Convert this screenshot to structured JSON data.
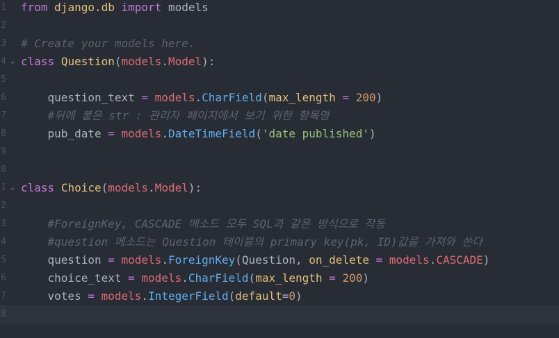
{
  "editor": {
    "language": "python",
    "lines": [
      {
        "num": "1",
        "fold": false,
        "segments": [
          {
            "t": "from",
            "c": "kw"
          },
          {
            "t": " "
          },
          {
            "t": "django.db",
            "c": "mod"
          },
          {
            "t": " "
          },
          {
            "t": "import",
            "c": "kw"
          },
          {
            "t": " models"
          }
        ]
      },
      {
        "num": "2",
        "fold": false,
        "segments": []
      },
      {
        "num": "3",
        "fold": false,
        "segments": [
          {
            "t": "# Create your models here.",
            "c": "cmt"
          }
        ]
      },
      {
        "num": "4",
        "fold": true,
        "segments": [
          {
            "t": "class",
            "c": "kw"
          },
          {
            "t": " "
          },
          {
            "t": "Question",
            "c": "cls"
          },
          {
            "t": "("
          },
          {
            "t": "models",
            "c": "name"
          },
          {
            "t": "."
          },
          {
            "t": "Model",
            "c": "name"
          },
          {
            "t": "):"
          }
        ]
      },
      {
        "num": "5",
        "fold": false,
        "segments": []
      },
      {
        "num": "6",
        "fold": false,
        "segments": [
          {
            "t": "    question_text "
          },
          {
            "t": "=",
            "c": "kw"
          },
          {
            "t": " "
          },
          {
            "t": "models",
            "c": "name"
          },
          {
            "t": "."
          },
          {
            "t": "CharField",
            "c": "attr"
          },
          {
            "t": "("
          },
          {
            "t": "max_length",
            "c": "param"
          },
          {
            "t": " "
          },
          {
            "t": "=",
            "c": "kw"
          },
          {
            "t": " "
          },
          {
            "t": "200",
            "c": "num"
          },
          {
            "t": ")"
          }
        ]
      },
      {
        "num": "7",
        "fold": false,
        "segments": [
          {
            "t": "    "
          },
          {
            "t": "#뒤에 붙은 str : 관리자 페이지에서 보기 위한 항목명",
            "c": "cmt"
          }
        ]
      },
      {
        "num": "8",
        "fold": false,
        "segments": [
          {
            "t": "    pub_date "
          },
          {
            "t": "=",
            "c": "kw"
          },
          {
            "t": " "
          },
          {
            "t": "models",
            "c": "name"
          },
          {
            "t": "."
          },
          {
            "t": "DateTimeField",
            "c": "attr"
          },
          {
            "t": "("
          },
          {
            "t": "'date published'",
            "c": "str"
          },
          {
            "t": ")"
          }
        ]
      },
      {
        "num": "9",
        "fold": false,
        "segments": []
      },
      {
        "num": "0",
        "fold": false,
        "segments": []
      },
      {
        "num": "1",
        "fold": true,
        "segments": [
          {
            "t": "class",
            "c": "kw"
          },
          {
            "t": " "
          },
          {
            "t": "Choice",
            "c": "cls"
          },
          {
            "t": "("
          },
          {
            "t": "models",
            "c": "name"
          },
          {
            "t": "."
          },
          {
            "t": "Model",
            "c": "name"
          },
          {
            "t": "):"
          }
        ]
      },
      {
        "num": "2",
        "fold": false,
        "segments": []
      },
      {
        "num": "3",
        "fold": false,
        "segments": [
          {
            "t": "    "
          },
          {
            "t": "#ForeignKey, CASCADE 메소드 모두 SQL과 같은 방식으로 작동",
            "c": "cmt"
          }
        ]
      },
      {
        "num": "4",
        "fold": false,
        "segments": [
          {
            "t": "    "
          },
          {
            "t": "#question 메소드는 Question 테이블의 primary key(pk, ID)값을 가져와 쓴다",
            "c": "cmt"
          }
        ]
      },
      {
        "num": "5",
        "fold": false,
        "segments": [
          {
            "t": "    question "
          },
          {
            "t": "=",
            "c": "kw"
          },
          {
            "t": " "
          },
          {
            "t": "models",
            "c": "name"
          },
          {
            "t": "."
          },
          {
            "t": "ForeignKey",
            "c": "attr"
          },
          {
            "t": "(Question, "
          },
          {
            "t": "on_delete",
            "c": "param"
          },
          {
            "t": " "
          },
          {
            "t": "=",
            "c": "kw"
          },
          {
            "t": " "
          },
          {
            "t": "models",
            "c": "name"
          },
          {
            "t": "."
          },
          {
            "t": "CASCADE",
            "c": "name"
          },
          {
            "t": ")"
          }
        ]
      },
      {
        "num": "6",
        "fold": false,
        "segments": [
          {
            "t": "    choice_text "
          },
          {
            "t": "=",
            "c": "kw"
          },
          {
            "t": " "
          },
          {
            "t": "models",
            "c": "name"
          },
          {
            "t": "."
          },
          {
            "t": "CharField",
            "c": "attr"
          },
          {
            "t": "("
          },
          {
            "t": "max_length",
            "c": "param"
          },
          {
            "t": " "
          },
          {
            "t": "=",
            "c": "kw"
          },
          {
            "t": " "
          },
          {
            "t": "200",
            "c": "num"
          },
          {
            "t": ")"
          }
        ]
      },
      {
        "num": "7",
        "fold": false,
        "segments": [
          {
            "t": "    votes "
          },
          {
            "t": "=",
            "c": "kw"
          },
          {
            "t": " "
          },
          {
            "t": "models",
            "c": "name"
          },
          {
            "t": "."
          },
          {
            "t": "IntegerField",
            "c": "attr"
          },
          {
            "t": "("
          },
          {
            "t": "default",
            "c": "param"
          },
          {
            "t": "="
          },
          {
            "t": "0",
            "c": "num"
          },
          {
            "t": ")"
          }
        ]
      },
      {
        "num": "8",
        "fold": false,
        "active": true,
        "segments": []
      }
    ]
  },
  "colors": {
    "background": "#282c34",
    "keyword": "#c678dd",
    "class_name": "#e5c07b",
    "function": "#61afef",
    "number": "#d19a66",
    "string": "#98c379",
    "comment": "#5c6370",
    "variable": "#e06c75"
  },
  "icons": {
    "fold": "chevron-down-icon"
  }
}
